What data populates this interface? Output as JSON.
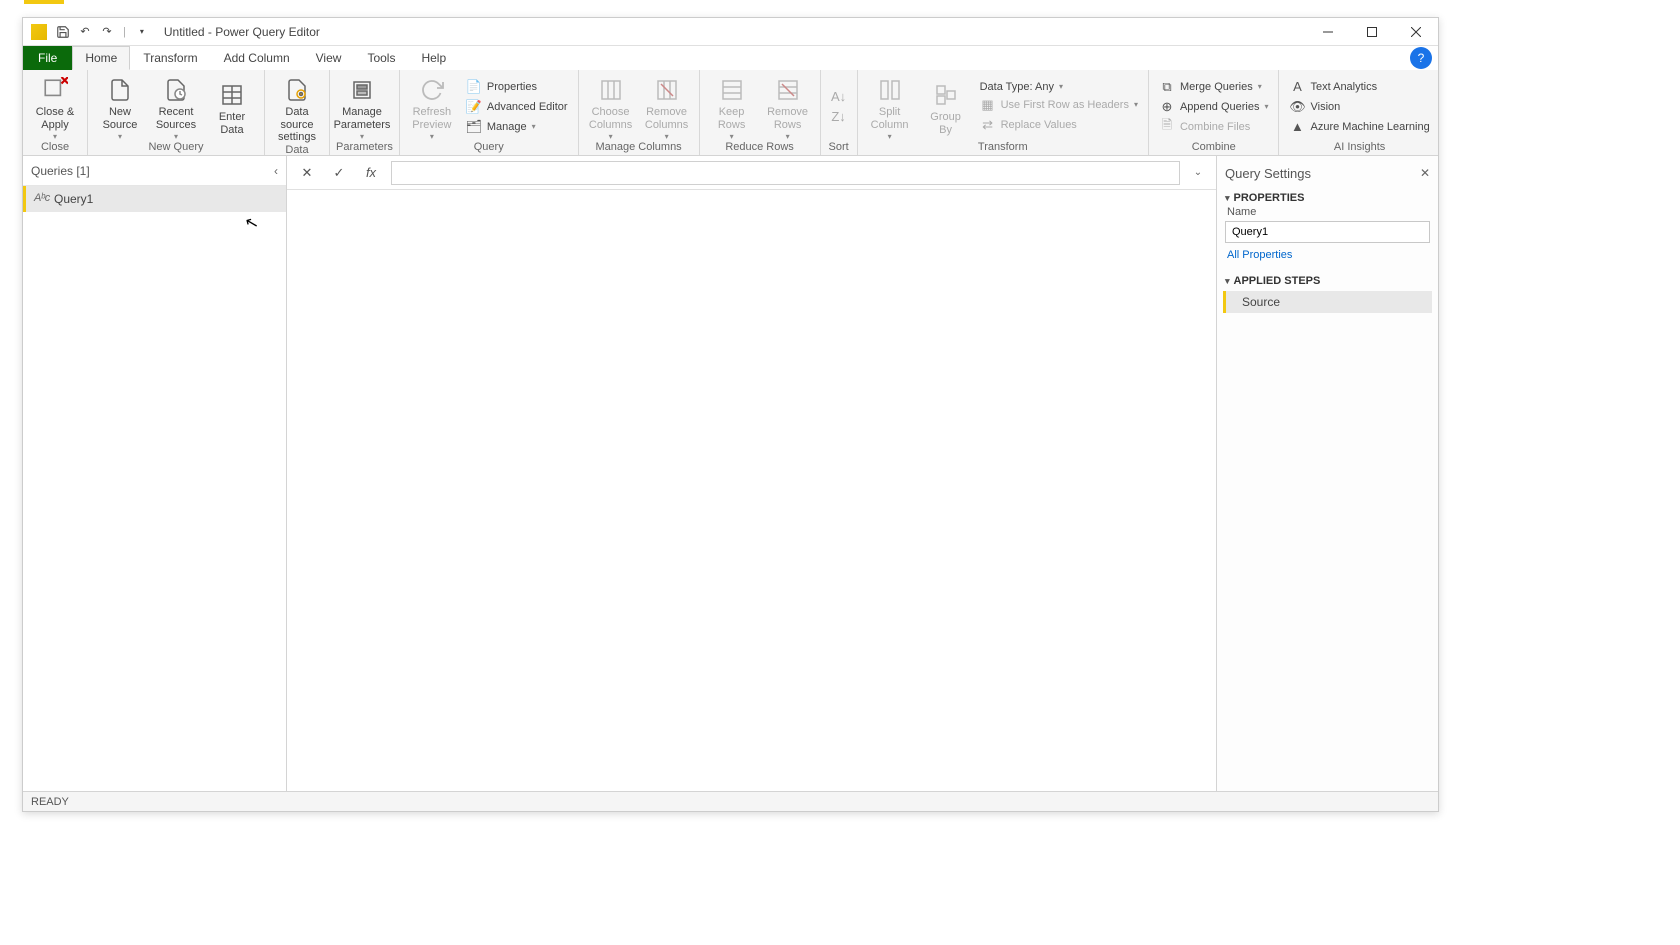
{
  "window": {
    "title": "Untitled - Power Query Editor"
  },
  "tabs": {
    "file": "File",
    "home": "Home",
    "transform": "Transform",
    "add_column": "Add Column",
    "view": "View",
    "tools": "Tools",
    "help": "Help"
  },
  "ribbon": {
    "close": {
      "close_apply": "Close &\nApply",
      "group": "Close"
    },
    "new_query": {
      "new_source": "New\nSource",
      "recent_sources": "Recent\nSources",
      "enter_data": "Enter\nData",
      "group": "New Query"
    },
    "data_sources": {
      "settings": "Data source\nsettings",
      "group": "Data Sources"
    },
    "parameters": {
      "manage": "Manage\nParameters",
      "group": "Parameters"
    },
    "query": {
      "refresh": "Refresh\nPreview",
      "properties": "Properties",
      "advanced": "Advanced Editor",
      "manage": "Manage",
      "group": "Query"
    },
    "manage_columns": {
      "choose": "Choose\nColumns",
      "remove": "Remove\nColumns",
      "group": "Manage Columns"
    },
    "reduce_rows": {
      "keep": "Keep\nRows",
      "remove": "Remove\nRows",
      "group": "Reduce Rows"
    },
    "sort": {
      "group": "Sort"
    },
    "transform": {
      "split": "Split\nColumn",
      "group_by": "Group\nBy",
      "data_type": "Data Type: Any",
      "first_row": "Use First Row as Headers",
      "replace": "Replace Values",
      "group": "Transform"
    },
    "combine": {
      "merge": "Merge Queries",
      "append": "Append Queries",
      "files": "Combine Files",
      "group": "Combine"
    },
    "ai": {
      "text": "Text Analytics",
      "vision": "Vision",
      "ml": "Azure Machine Learning",
      "group": "AI Insights"
    }
  },
  "queries_pane": {
    "header": "Queries [1]",
    "items": [
      {
        "name": "Query1"
      }
    ]
  },
  "formula_bar": {
    "value": ""
  },
  "settings": {
    "title": "Query Settings",
    "properties_section": "PROPERTIES",
    "name_label": "Name",
    "name_value": "Query1",
    "all_properties": "All Properties",
    "applied_steps_section": "APPLIED STEPS",
    "steps": [
      {
        "label": "Source"
      }
    ]
  },
  "status": {
    "text": "READY"
  }
}
